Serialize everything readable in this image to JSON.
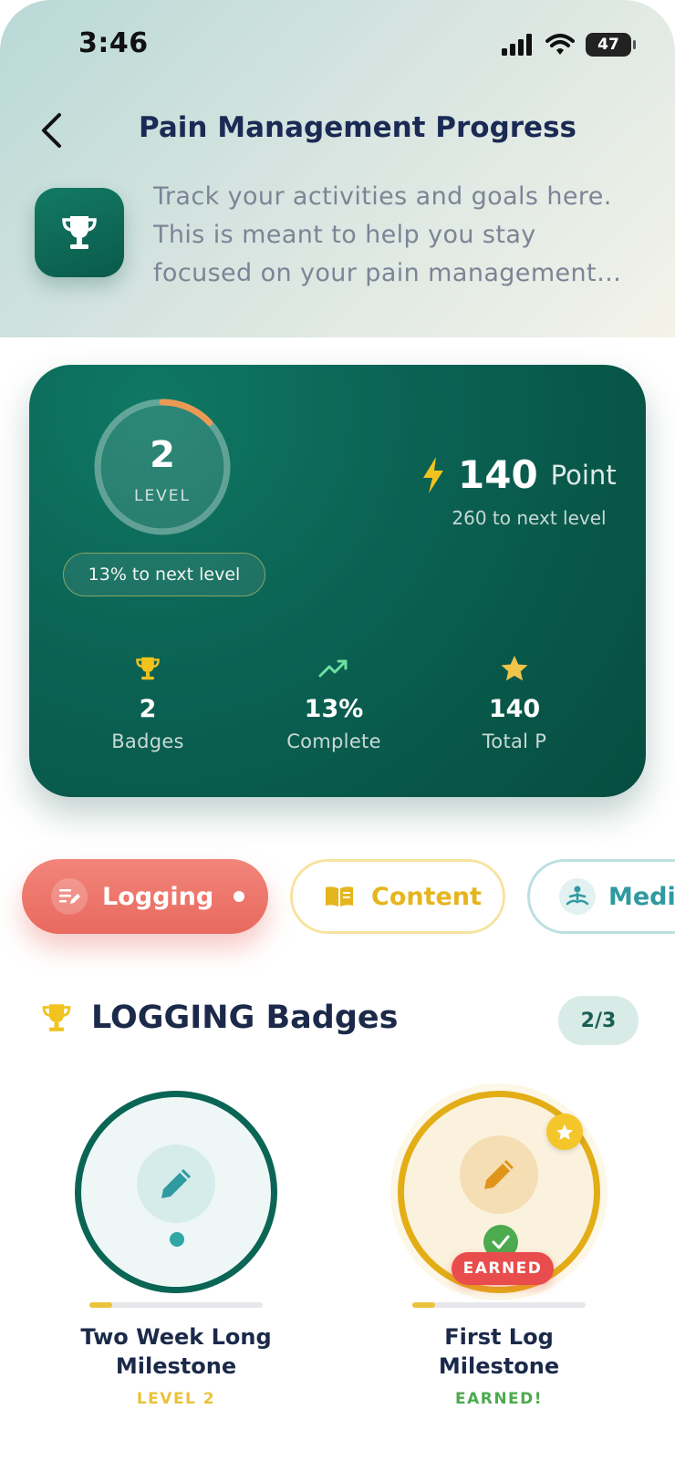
{
  "status_bar": {
    "time": "3:46",
    "battery": "47"
  },
  "header": {
    "title": "Pain Management Progress",
    "subtitle_lines": [
      "Track your activities and goals here.",
      "This is meant to help you stay",
      "focused on your pain management…"
    ]
  },
  "level_card": {
    "level_number": "2",
    "level_label": "LEVEL",
    "level_progress_fraction": 0.13,
    "next_level_pill": "13% to next level",
    "points_value": "140",
    "points_unit": "Point",
    "points_to_next": "260 to next level",
    "stats": [
      {
        "value": "2",
        "label": "Badges",
        "icon": "trophy-icon"
      },
      {
        "value": "13%",
        "label": "Complete",
        "icon": "trend-up-icon"
      },
      {
        "value": "140",
        "label": "Total P",
        "icon": "star-icon"
      }
    ]
  },
  "categories": [
    {
      "label": "Logging",
      "icon": "edit-note-icon",
      "active": true
    },
    {
      "label": "Content",
      "icon": "book-icon",
      "active": false
    },
    {
      "label": "Medit",
      "icon": "meditation-icon",
      "active": false
    }
  ],
  "badges_section": {
    "title": "LOGGING Badges",
    "count": "2/3",
    "badges": [
      {
        "name_line1": "Two Week Long",
        "name_line2": "Milestone",
        "status": "LEVEL 2",
        "progress_fraction": 0.13,
        "earned": false
      },
      {
        "name_line1": "First Log",
        "name_line2": "Milestone",
        "status": "EARNED!",
        "tag": "EARNED",
        "progress_fraction": 0.13,
        "earned": true
      }
    ]
  },
  "colors": {
    "brand_green": "#0b6354",
    "accent_coral": "#ec6f64",
    "accent_gold": "#e3ad16",
    "earned_green": "#4caa4f",
    "earned_red": "#e94c4c"
  }
}
